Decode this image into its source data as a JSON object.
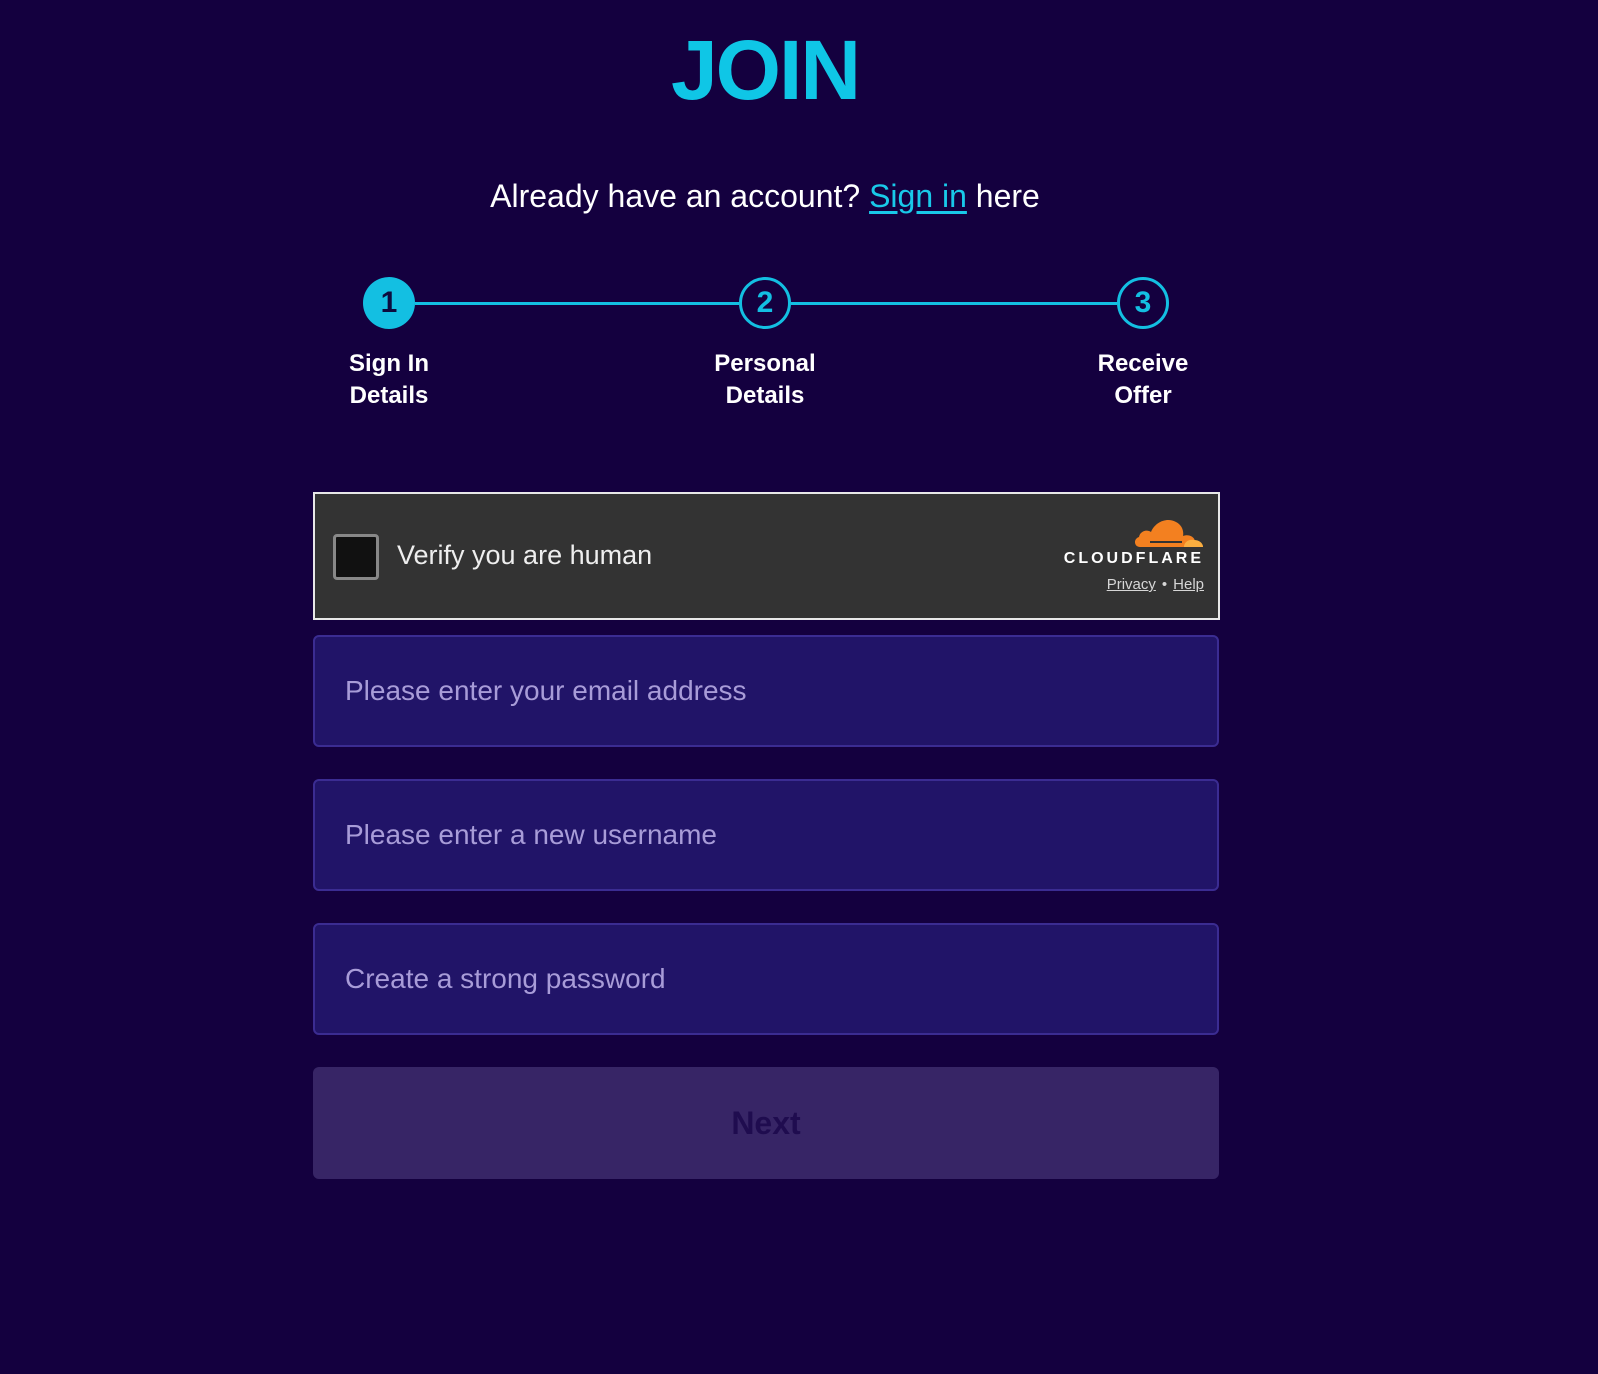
{
  "header": {
    "title": "JOIN"
  },
  "signin_prompt": {
    "before": "Already have an account? ",
    "link": "Sign in",
    "after": " here"
  },
  "steps": [
    {
      "number": "1",
      "line1": "Sign In",
      "line2": "Details",
      "state": "active"
    },
    {
      "number": "2",
      "line1": "Personal",
      "line2": "Details",
      "state": "inactive"
    },
    {
      "number": "3",
      "line1": "Receive",
      "line2": "Offer",
      "state": "inactive"
    }
  ],
  "captcha": {
    "label": "Verify you are human",
    "brand": "CLOUDFLARE",
    "privacy": "Privacy",
    "separator": "•",
    "help": "Help"
  },
  "form": {
    "email_placeholder": "Please enter your email address",
    "username_placeholder": "Please enter a new username",
    "password_placeholder": "Create a strong password",
    "next_label": "Next"
  },
  "colors": {
    "background": "#14003f",
    "accent": "#13bfe2",
    "field_bg": "#211468",
    "captcha_bg": "#333333",
    "cloudflare_orange": "#f38020"
  }
}
